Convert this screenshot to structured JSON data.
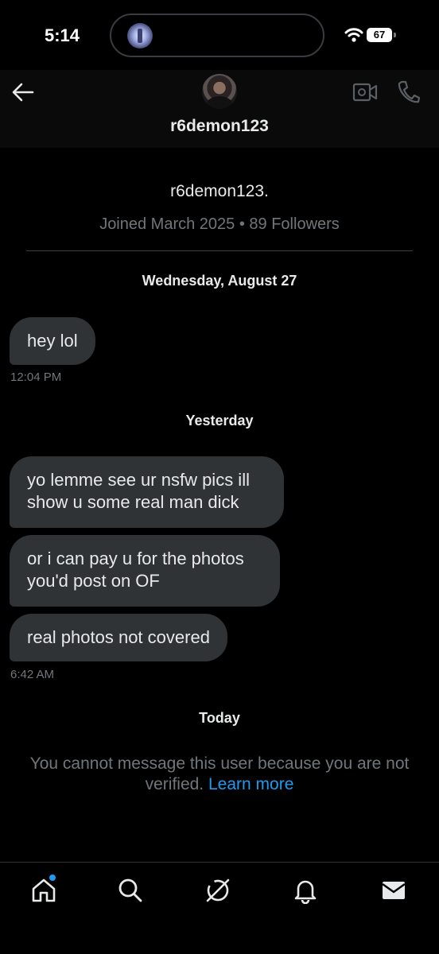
{
  "status_bar": {
    "time": "5:14",
    "battery": "67"
  },
  "header": {
    "username": "r6demon123"
  },
  "profile": {
    "display_name": "r6demon123.",
    "meta": "Joined March 2025 • 89 Followers"
  },
  "conversation": [
    {
      "date": "Wednesday, August 27",
      "messages": [
        "hey lol"
      ],
      "time": "12:04 PM"
    },
    {
      "date": "Yesterday",
      "messages": [
        "yo lemme see ur nsfw pics ill show u some real man dick",
        "or i can pay u for the photos you'd post on OF",
        "real photos not covered"
      ],
      "time": "6:42 AM"
    },
    {
      "date": "Today"
    }
  ],
  "notice": {
    "text": "You cannot message this user because you are not verified.",
    "link": "Learn more"
  },
  "nav": {
    "items": [
      "home-icon",
      "search-icon",
      "grok-icon",
      "notifications-icon",
      "messages-icon"
    ],
    "accent": "#1d9bf0"
  }
}
